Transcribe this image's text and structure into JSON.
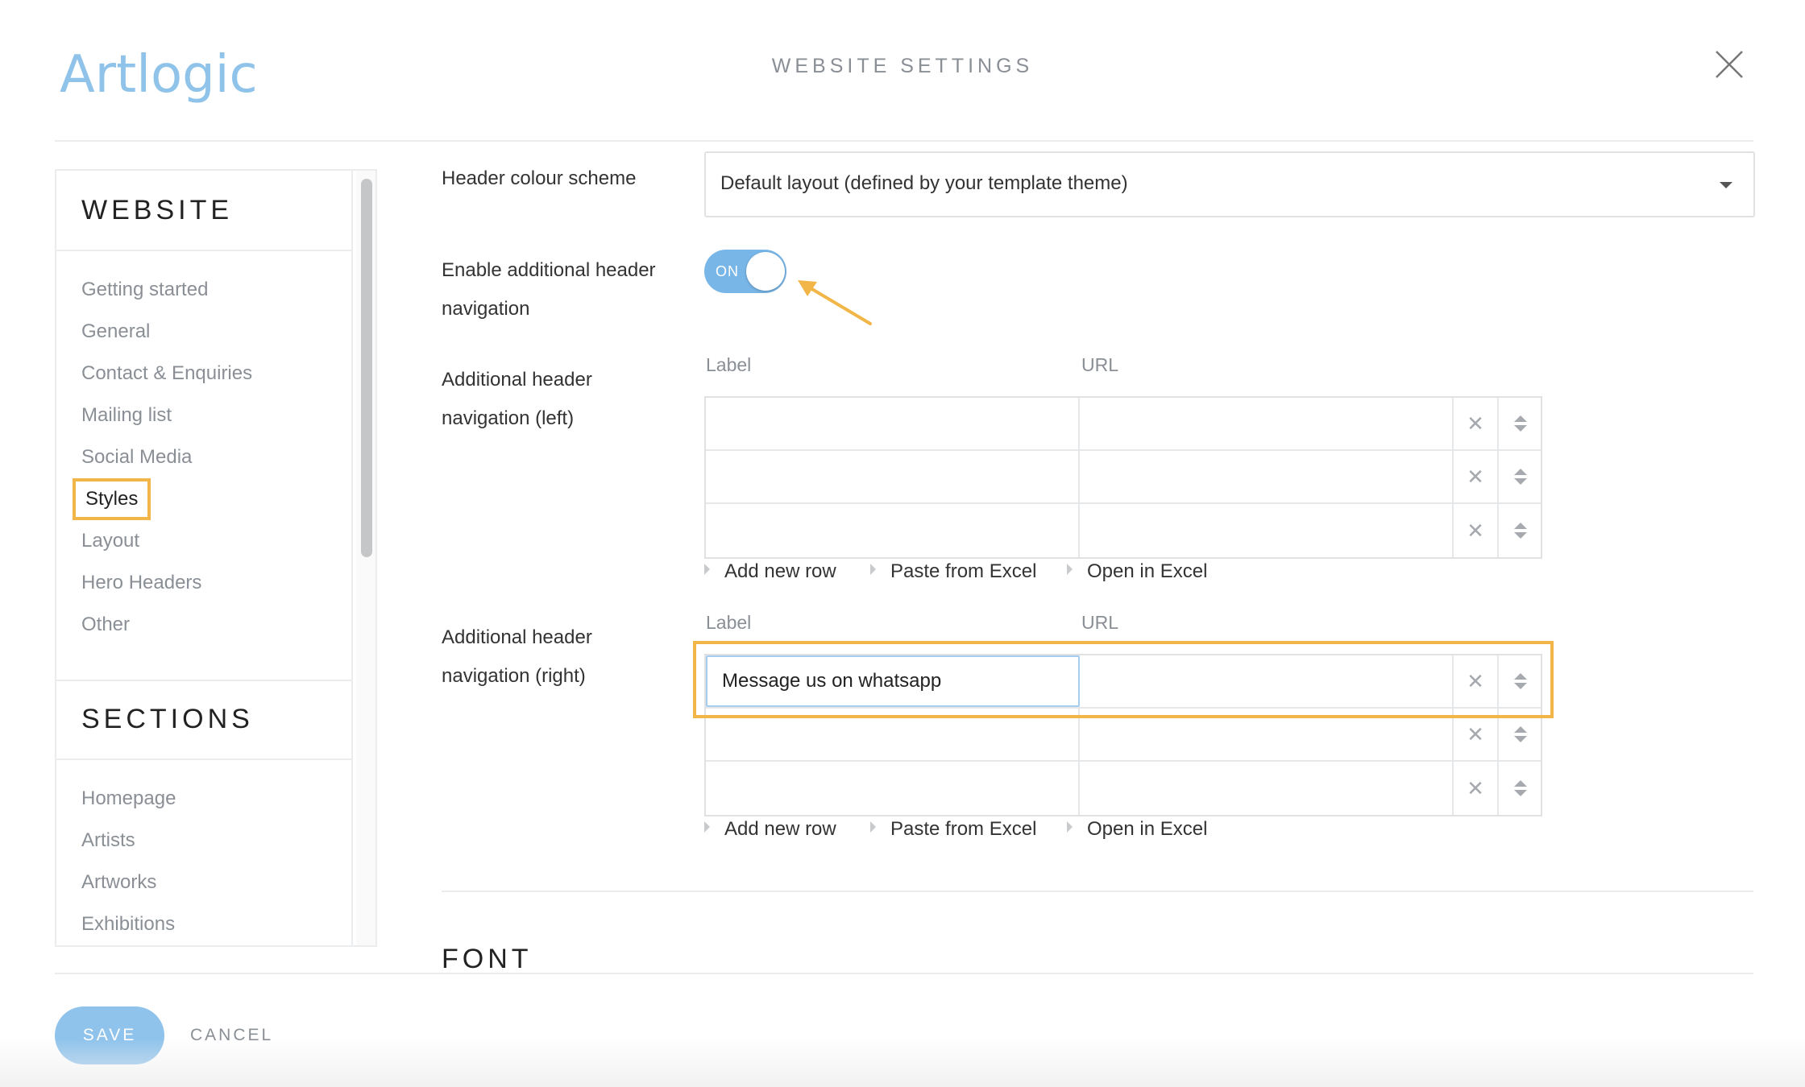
{
  "header": {
    "logo_text": "Artlogic",
    "title": "WEBSITE SETTINGS",
    "close_icon": "close-icon"
  },
  "sidebar": {
    "website_heading": "WEBSITE",
    "website_items": [
      {
        "label": "Getting started"
      },
      {
        "label": "General"
      },
      {
        "label": "Contact & Enquiries"
      },
      {
        "label": "Mailing list"
      },
      {
        "label": "Social Media"
      },
      {
        "label": "Styles",
        "active": true
      },
      {
        "label": "Layout"
      },
      {
        "label": "Hero Headers"
      },
      {
        "label": "Other"
      }
    ],
    "sections_heading": "SECTIONS",
    "sections_items": [
      {
        "label": "Homepage"
      },
      {
        "label": "Artists"
      },
      {
        "label": "Artworks"
      },
      {
        "label": "Exhibitions"
      }
    ]
  },
  "form": {
    "header_colour": {
      "label": "Header colour scheme",
      "value": "Default layout (defined by your template theme)"
    },
    "enable_nav": {
      "label_line1": "Enable additional header",
      "label_line2": "navigation",
      "toggle_text": "ON",
      "enabled": true
    },
    "nav_left": {
      "label_line1": "Additional header",
      "label_line2": "navigation (left)",
      "col_label": "Label",
      "col_url": "URL",
      "rows": [
        {
          "label": "",
          "url": ""
        },
        {
          "label": "",
          "url": ""
        },
        {
          "label": "",
          "url": ""
        }
      ]
    },
    "nav_right": {
      "label_line1": "Additional header",
      "label_line2": "navigation (right)",
      "col_label": "Label",
      "col_url": "URL",
      "rows": [
        {
          "label": "Message us on whatsapp",
          "url": ""
        },
        {
          "label": "",
          "url": ""
        },
        {
          "label": "",
          "url": ""
        }
      ]
    },
    "grid_actions": {
      "add_row": "Add new row",
      "paste_excel": "Paste from Excel",
      "open_excel": "Open in Excel"
    },
    "font_heading": "FONT"
  },
  "footer": {
    "save_label": "SAVE",
    "cancel_label": "CANCEL"
  },
  "colors": {
    "accent": "#8fc3ec",
    "highlight": "#f2b548",
    "toggle_on": "#78b6e8"
  }
}
